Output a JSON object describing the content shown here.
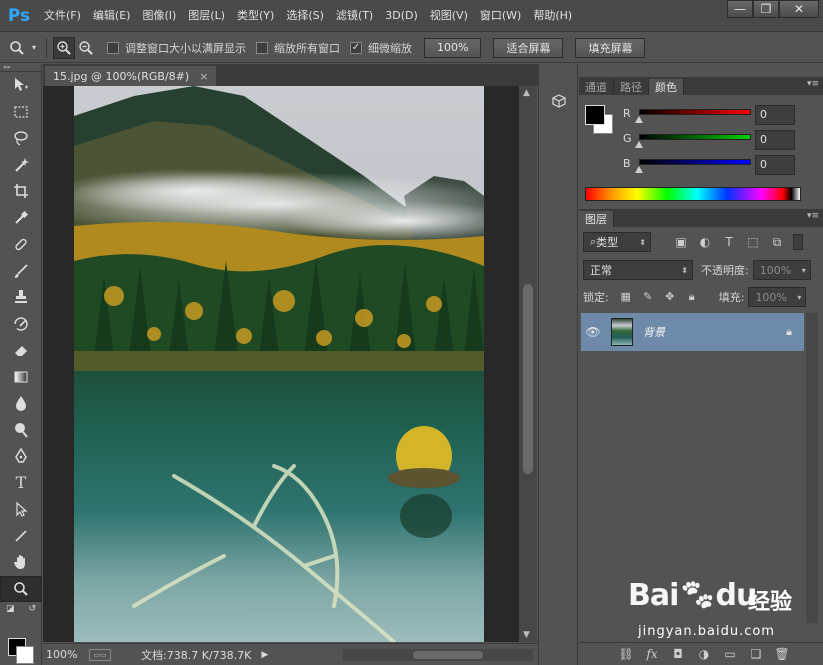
{
  "app": {
    "logo": "Ps"
  },
  "menu": [
    "文件(F)",
    "编辑(E)",
    "图像(I)",
    "图层(L)",
    "类型(Y)",
    "选择(S)",
    "滤镜(T)",
    "3D(D)",
    "视图(V)",
    "窗口(W)",
    "帮助(H)"
  ],
  "window_controls": {
    "minimize": "—",
    "restore": "❐",
    "close": "✕"
  },
  "options": {
    "checkbox1": {
      "label": "调整窗口大小以满屏显示",
      "checked": false
    },
    "checkbox2": {
      "label": "缩放所有窗口",
      "checked": false
    },
    "checkbox3": {
      "label": "细微缩放",
      "checked": true
    },
    "zoom_btn": "100%",
    "fit_btn": "适合屏幕",
    "fill_btn": "填充屏幕"
  },
  "document": {
    "tab_title": "15.jpg @ 100%(RGB/8#)",
    "tab_close": "×"
  },
  "status": {
    "zoom": "100%",
    "doc_info": "文档:738.7 K/738.7K"
  },
  "color_panel": {
    "tabs": [
      "通道",
      "路径",
      "颜色"
    ],
    "active_tab": 2,
    "r_label": "R",
    "r_value": "0",
    "g_label": "G",
    "g_value": "0",
    "b_label": "B",
    "b_value": "0",
    "colors": {
      "r_track": "#ff0000",
      "g_track": "#00c000",
      "b_track": "#0000ff"
    }
  },
  "layers_panel": {
    "tab": "图层",
    "filter_kind": "类型",
    "blend_mode": "正常",
    "opacity_label": "不透明度:",
    "opacity_value": "100%",
    "lock_label": "锁定:",
    "fill_label": "填充:",
    "fill_value": "100%",
    "layer_name": "背景"
  },
  "watermark": {
    "brand_a": "Bai",
    "brand_b": "du",
    "sub": "经验",
    "url": "jingyan.baidu.com"
  }
}
